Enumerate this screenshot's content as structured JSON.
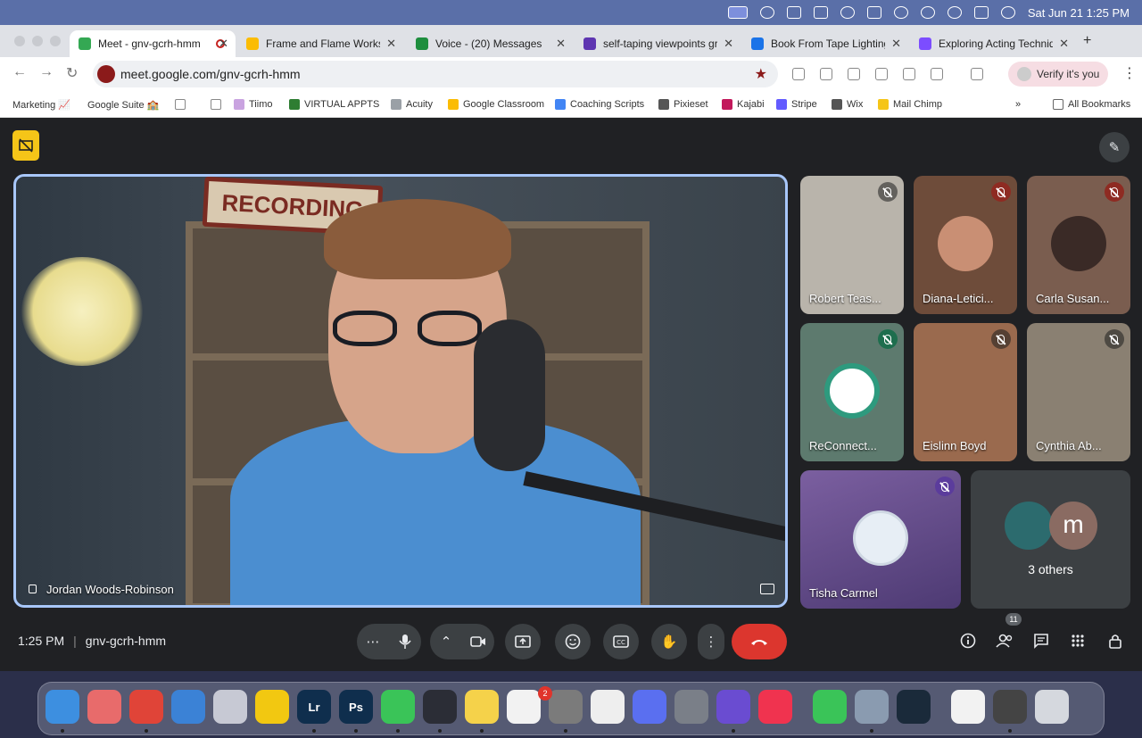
{
  "menubar": {
    "clock": "Sat Jun 21  1:25 PM"
  },
  "browser": {
    "tabs": [
      {
        "title": "Meet - gnv-gcrh-hmm",
        "color": "#34a853"
      },
      {
        "title": "Frame and Flame Worksho",
        "color": "#fbbc04"
      },
      {
        "title": "Voice - (20) Messages",
        "color": "#1e8e3e"
      },
      {
        "title": "self-taping viewpoints gri",
        "color": "#5e35b1"
      },
      {
        "title": "Book From Tape Lighting S",
        "color": "#1a73e8"
      },
      {
        "title": "Exploring Acting Techniqu",
        "color": "#7c4dff"
      }
    ],
    "new_tab": "+",
    "url": "meet.google.com/gnv-gcrh-hmm",
    "verify": "Verify it's you",
    "bookmarks": [
      "Marketing 📈",
      "Google Suite 🏫",
      "Tiimo",
      "VIRTUAL APPTS",
      "Acuity",
      "Google Classroom",
      "Coaching Scripts",
      "Pixieset",
      "Kajabi",
      "Stripe",
      "Wix",
      "Mail Chimp"
    ],
    "all_bookmarks": "All Bookmarks"
  },
  "meet": {
    "main_speaker": "Jordan Woods-Robinson",
    "sign_text": "RECORDING",
    "participants": [
      {
        "name": "Robert Teas...",
        "bg": "#b9b4ab"
      },
      {
        "name": "Diana-Letici...",
        "bg": "#6e4c3a"
      },
      {
        "name": "Carla Susan...",
        "bg": "#7a5d4f"
      },
      {
        "name": "ReConnect...",
        "bg": "#5d7a6e"
      },
      {
        "name": "Eislinn Boyd",
        "bg": "#9a6a4e"
      },
      {
        "name": "Cynthia Ab...",
        "bg": "#8a8072"
      }
    ],
    "tisha": "Tisha Carmel",
    "others": "3 others",
    "others_initial": "m",
    "time": "1:25 PM",
    "meeting_code": "gnv-gcrh-hmm",
    "participant_count": "11"
  },
  "dock": [
    {
      "name": "Finder",
      "label": "",
      "color": "#3d8fe0"
    },
    {
      "name": "Safari",
      "label": "",
      "color": "#e86b6b"
    },
    {
      "name": "Chrome",
      "label": "",
      "color": "#e04438"
    },
    {
      "name": "Mail",
      "label": "",
      "color": "#3b82d6"
    },
    {
      "name": "App1",
      "label": "",
      "color": "#c7c9d4"
    },
    {
      "name": "App2",
      "label": "",
      "color": "#f2c811"
    },
    {
      "name": "Lightroom",
      "label": "Lr",
      "color": "#0f2e4d"
    },
    {
      "name": "Photoshop",
      "label": "Ps",
      "color": "#0f2e4d"
    },
    {
      "name": "Messages",
      "label": "",
      "color": "#3ac458"
    },
    {
      "name": "DaVinci",
      "label": "",
      "color": "#2b2d36"
    },
    {
      "name": "Notes",
      "label": "",
      "color": "#f5d24a"
    },
    {
      "name": "Reminders",
      "label": "",
      "color": "#f2f2f2"
    },
    {
      "name": "Settings",
      "label": "",
      "color": "#7b7b7b"
    },
    {
      "name": "ChatGPT",
      "label": "",
      "color": "#eeeeee"
    },
    {
      "name": "Perplexity",
      "label": "",
      "color": "#5a6ff0"
    },
    {
      "name": "iPhone",
      "label": "",
      "color": "#7a7f88"
    },
    {
      "name": "App3",
      "label": "",
      "color": "#6a4cd1"
    },
    {
      "name": "Music",
      "label": "",
      "color": "#f0334f"
    },
    {
      "name": "FaceTime",
      "label": "",
      "color": "#3ac458"
    },
    {
      "name": "Preview",
      "label": "",
      "color": "#8a9bb0"
    },
    {
      "name": "QuickTime",
      "label": "",
      "color": "#1a2a3a"
    },
    {
      "name": "Doc",
      "label": "",
      "color": "#f2f2f2"
    },
    {
      "name": "Window",
      "label": "",
      "color": "#444444"
    },
    {
      "name": "Trash",
      "label": "",
      "color": "#d5d8de"
    }
  ],
  "reminders_badge": "2"
}
